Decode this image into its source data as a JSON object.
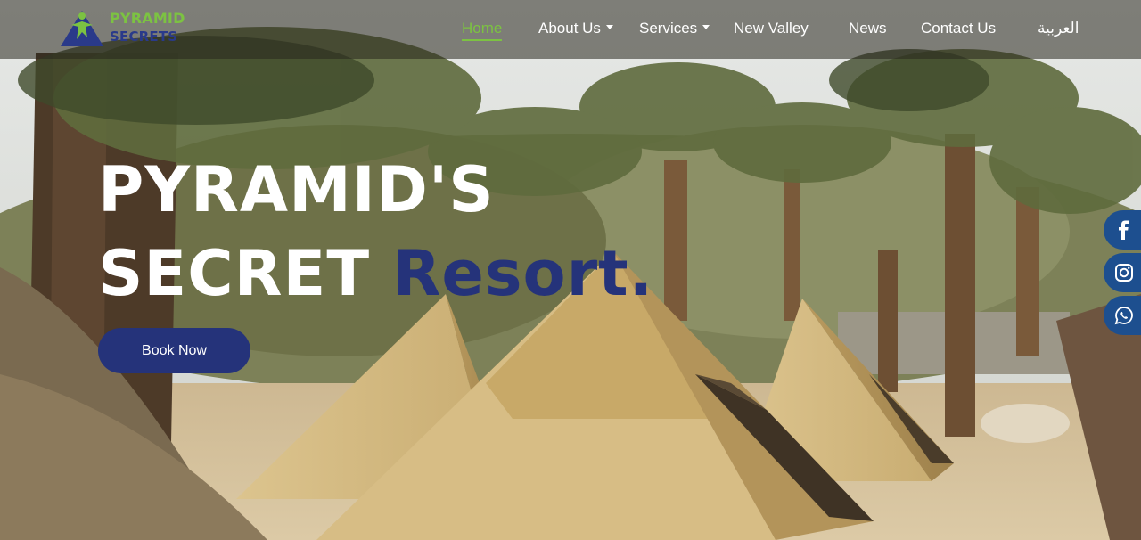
{
  "brand": {
    "name_line1": "PYRAMID",
    "name_line2": "SECRETS",
    "logo_icon": "pyramid-figure-icon",
    "colors": {
      "green": "#7cc242",
      "navy": "#25337a"
    }
  },
  "nav": {
    "items": [
      {
        "label": "Home",
        "active": true,
        "dropdown": false
      },
      {
        "label": "About Us",
        "active": false,
        "dropdown": true
      },
      {
        "label": "Services",
        "active": false,
        "dropdown": true
      },
      {
        "label": "New Valley",
        "active": false,
        "dropdown": false
      },
      {
        "label": "News",
        "active": false,
        "dropdown": false
      },
      {
        "label": "Contact Us",
        "active": false,
        "dropdown": false
      },
      {
        "label": "العربية",
        "active": false,
        "dropdown": false
      }
    ]
  },
  "hero": {
    "title_line1": "PYRAMID'S",
    "title_line2_part1": "SECRET",
    "title_line2_part2": "Resort.",
    "cta_label": "Book Now"
  },
  "social": {
    "items": [
      {
        "name": "facebook",
        "icon": "facebook-icon"
      },
      {
        "name": "instagram",
        "icon": "instagram-icon"
      },
      {
        "name": "whatsapp",
        "icon": "whatsapp-icon"
      }
    ],
    "color": "#1d4f8f"
  }
}
